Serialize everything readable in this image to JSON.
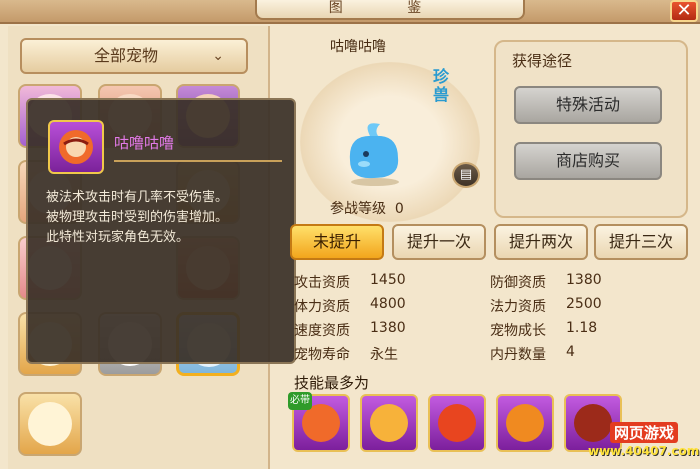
{
  "window": {
    "title": "图 鉴"
  },
  "left": {
    "category_label": "全部宠物",
    "chevron_icon": "chevron-down-icon"
  },
  "tooltip": {
    "name": "咕噜咕噜",
    "lines": [
      "被法术攻击时有几率不受伤害。",
      "被物理攻击时受到的伤害增加。",
      "此特性对玩家角色无效。"
    ]
  },
  "pet": {
    "name": "咕噜咕噜",
    "rarity": "珍兽",
    "battle_level_label": "参战等级",
    "battle_level": "0"
  },
  "source": {
    "title": "获得途径",
    "buttons": [
      "特殊活动",
      "商店购买"
    ]
  },
  "tabs": [
    "未提升",
    "提升一次",
    "提升两次",
    "提升三次"
  ],
  "stats": [
    {
      "label": "攻击资质",
      "value": "1450"
    },
    {
      "label": "防御资质",
      "value": "1380"
    },
    {
      "label": "体力资质",
      "value": "4800"
    },
    {
      "label": "法力资质",
      "value": "2500"
    },
    {
      "label": "速度资质",
      "value": "1380"
    },
    {
      "label": "宠物成长",
      "value": "1.18"
    },
    {
      "label": "宠物寿命",
      "value": "永生"
    },
    {
      "label": "内丹数量",
      "value": "4"
    }
  ],
  "skills": {
    "title": "技能最多为",
    "must_badge": "必带"
  },
  "watermark": {
    "name": "网页游戏",
    "url": "www.40407.com"
  },
  "colors": {
    "active_tab": "#f2a51c",
    "tooltip_name": "#e27ae8",
    "rarity": "#2a9bd0"
  }
}
